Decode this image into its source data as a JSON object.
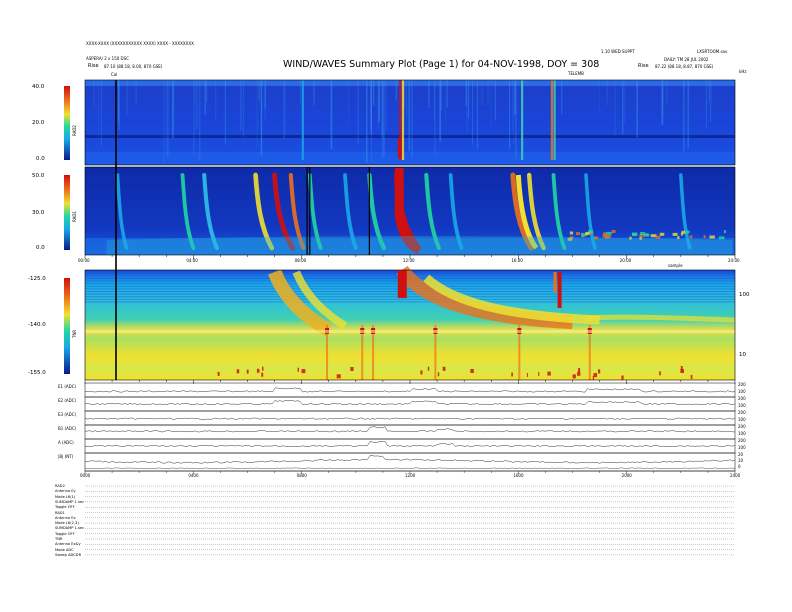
{
  "header": {
    "left_line1": "XXXX-XXXX (XXXXXXXXXXX XXXX) XXXX - XXXXXXXX",
    "left_line2": "ASPERA/ 2 x 150 DSC",
    "left_rise_label": "Rise",
    "left_rise_value": "87.10 (88.18, 8.00, 870 GSE)",
    "title": "WIND/WAVES Summary Plot (Page 1) for 04-NOV-1998, DOY = 308",
    "right_line1a": "1.10 WED SUPPT",
    "right_line1b": "LXSRTOOM.sav",
    "right_line2": "DAILY: TM 28 JUL 2002",
    "right_rise_label": "Rise",
    "right_rise_value": "87.22 (88.18, 8.87, 870 GSE)",
    "top_marker": "Cal",
    "freq_label_top": "TELEMB",
    "khz_label": "kHz"
  },
  "panels": {
    "rad2": {
      "name": "RAD2",
      "ticks": [
        "40.0",
        "20.0",
        "0.0"
      ]
    },
    "rad1": {
      "name": "RAD1",
      "ticks": [
        "50.0",
        "30.0",
        "0.0"
      ]
    },
    "tnr": {
      "name": "TNR",
      "ticks": [
        "-125.0",
        "-140.0",
        "-155.0"
      ],
      "right_ticks": [
        "100",
        "10"
      ],
      "right_label": "sample"
    }
  },
  "time_axis": {
    "ticks": [
      "00:00",
      "04:00",
      "08:00",
      "12:00",
      "16:00",
      "20:00",
      "24:00"
    ]
  },
  "traces": [
    {
      "label": "E1 (ADC)",
      "right": [
        "200",
        "100"
      ]
    },
    {
      "label": "E2 (ADC)",
      "right": [
        "200",
        "100"
      ]
    },
    {
      "label": "E3 (ADC)",
      "right": [
        "200",
        "100"
      ]
    },
    {
      "label": "B1 (ADC)",
      "right": [
        "200",
        "100"
      ]
    },
    {
      "label": "A (ADC)",
      "right": [
        "200",
        "100"
      ]
    },
    {
      "label": "|B| (NT)",
      "right": [
        "20",
        "10",
        "0"
      ]
    }
  ],
  "bottom_axis": {
    "ticks": [
      "0000",
      "0400",
      "0800",
      "1200",
      "1600",
      "2000",
      "2400"
    ]
  },
  "status": {
    "rad2": [
      "RAD2",
      "Antenna  Ey",
      "Mode  L6(1)",
      "SUMDAMP 1.sec",
      "Toggle  OFF"
    ],
    "rad1": [
      "RAD1",
      "Antenna  Ex",
      "Mode  L6(2,3)",
      "SUMDAMP 1.sec",
      "Toggle  OFF"
    ],
    "tnr": [
      "TNR",
      "Antenna  Ex&y",
      "Mode  ADC",
      "Sweep  ADCDR"
    ]
  },
  "colors": {
    "background_field": "#1e3fd0",
    "deep": "#0a1a8a",
    "mid": "#18a8e8",
    "green": "#20d8a0",
    "yellow": "#f0e030",
    "orange": "#f07018",
    "red": "#d01010"
  },
  "chart_data": {
    "type": "heatmap",
    "title": "WIND/WAVES Summary Plot (Page 1) for 04-NOV-1998, DOY = 308",
    "x_range_hours": [
      0,
      24
    ],
    "bursts_hours": [
      7.1,
      8.1,
      11.6,
      16.0,
      17.5
    ],
    "panels": [
      "RAD2",
      "RAD1",
      "TNR"
    ],
    "traces": [
      "E1 (ADC)",
      "E2 (ADC)",
      "E3 (ADC)",
      "B1 (ADC)",
      "A (ADC)",
      "|B| (NT)"
    ]
  }
}
